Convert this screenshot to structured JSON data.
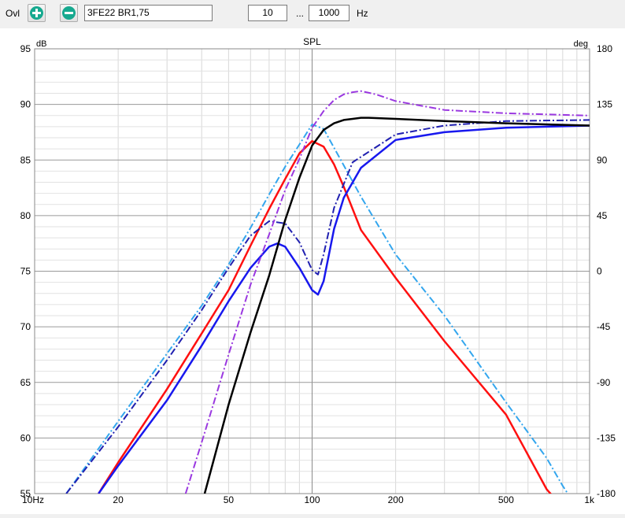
{
  "toolbar": {
    "ovl_label": "Ovl",
    "add_icon": "plus-circle-icon",
    "remove_icon": "minus-circle-icon",
    "preset_value": "3FE22 BR1,75",
    "freq_min": "10",
    "ellipsis": "...",
    "freq_max": "1000",
    "unit": "Hz"
  },
  "chart_data": {
    "type": "line",
    "title": "SPL",
    "xlabel": "",
    "ylabel": "dB",
    "y2label": "deg",
    "xscale": "log",
    "xlim": [
      10,
      1000
    ],
    "ylim": [
      55,
      95
    ],
    "y2lim": [
      -180,
      180
    ],
    "x_ticks": [
      {
        "value": 10,
        "label": "10Hz"
      },
      {
        "value": 20,
        "label": "20"
      },
      {
        "value": 50,
        "label": "50"
      },
      {
        "value": 100,
        "label": "100"
      },
      {
        "value": 200,
        "label": "200"
      },
      {
        "value": 500,
        "label": "500"
      },
      {
        "value": 1000,
        "label": "1k"
      }
    ],
    "y_ticks": [
      55,
      60,
      65,
      70,
      75,
      80,
      85,
      90,
      95
    ],
    "y2_ticks": [
      -180,
      -135,
      -90,
      -45,
      0,
      45,
      90,
      135,
      180
    ],
    "grid": true,
    "series": [
      {
        "color": "#33a6ee",
        "style": "dashdot",
        "width": 2,
        "x": [
          13,
          20,
          30,
          40,
          50,
          60,
          70,
          80,
          90,
          100,
          110,
          120,
          150,
          200,
          300,
          500,
          700,
          800,
          1000
        ],
        "y": [
          55,
          61.5,
          67.6,
          71.9,
          75.6,
          78.9,
          81.9,
          84.4,
          86.4,
          88.2,
          87.8,
          86.1,
          81.7,
          76.5,
          71,
          63.2,
          58.2,
          55.7,
          52
        ]
      },
      {
        "color": "#ff1010",
        "style": "solid",
        "width": 2.5,
        "x": [
          17,
          20,
          30,
          40,
          50,
          60,
          70,
          80,
          90,
          100,
          110,
          120,
          130,
          150,
          200,
          300,
          500,
          700,
          1000
        ],
        "y": [
          55,
          57.8,
          64.4,
          69.4,
          73.3,
          77.3,
          80.6,
          83.3,
          85.6,
          86.7,
          86.2,
          84.6,
          82.6,
          78.7,
          74.4,
          68.7,
          62.1,
          55.4,
          51
        ]
      },
      {
        "color": "#1818ee",
        "style": "solid",
        "width": 2.5,
        "x": [
          17,
          20,
          30,
          40,
          50,
          60,
          70,
          75,
          80,
          90,
          100,
          105,
          110,
          120,
          130,
          150,
          200,
          300,
          500,
          1000
        ],
        "y": [
          55,
          57.5,
          63.4,
          68.3,
          72.3,
          75.3,
          77.2,
          77.5,
          77.2,
          75.3,
          73.3,
          72.9,
          74.1,
          78.8,
          81.6,
          84.3,
          86.8,
          87.5,
          87.9,
          88.1
        ]
      },
      {
        "color": "#2020b0",
        "style": "dashdot",
        "width": 2,
        "x": [
          13,
          20,
          30,
          40,
          50,
          60,
          70,
          80,
          90,
          100,
          105,
          110,
          120,
          140,
          200,
          300,
          500,
          1000
        ],
        "y": [
          55,
          61,
          67,
          71.5,
          75.3,
          78.2,
          79.5,
          79.3,
          77.6,
          75.1,
          74.7,
          76.5,
          80.7,
          84.8,
          87.3,
          88.1,
          88.5,
          88.6
        ]
      },
      {
        "color": "#9a38e0",
        "style": "dashdot",
        "width": 2,
        "x": [
          35,
          40,
          50,
          60,
          70,
          80,
          90,
          100,
          110,
          120,
          130,
          140,
          150,
          170,
          200,
          300,
          500,
          1000
        ],
        "y": [
          55,
          59.6,
          67.5,
          73.8,
          78.3,
          82.3,
          85.1,
          87.9,
          89.4,
          90.4,
          90.9,
          91.1,
          91.2,
          90.9,
          90.3,
          89.5,
          89.2,
          89
        ]
      },
      {
        "color": "#000000",
        "style": "solid",
        "width": 2.5,
        "x": [
          41,
          50,
          60,
          70,
          80,
          90,
          100,
          110,
          120,
          130,
          140,
          150,
          160,
          200,
          300,
          500,
          1000
        ],
        "y": [
          55,
          63,
          69.5,
          74.6,
          79.6,
          83.4,
          86.3,
          87.7,
          88.3,
          88.6,
          88.7,
          88.8,
          88.8,
          88.7,
          88.5,
          88.3,
          88.1
        ]
      }
    ]
  }
}
